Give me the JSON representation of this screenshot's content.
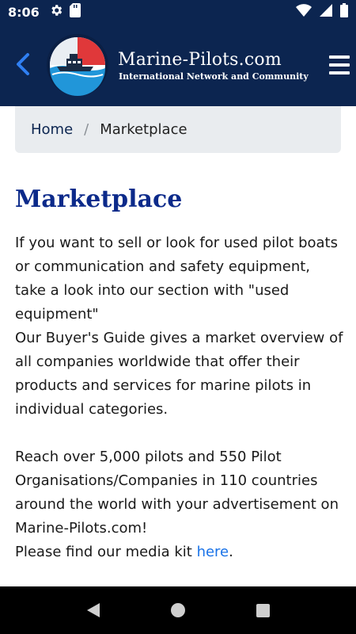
{
  "status_bar": {
    "time": "8:06",
    "icons_left": [
      "gear-icon",
      "sd-card-icon"
    ],
    "icons_right": [
      "wifi-icon",
      "signal-icon",
      "battery-icon"
    ]
  },
  "header": {
    "title": "Marine-Pilots.com",
    "subtitle": "International Network and Community",
    "background_color": "#0c2550"
  },
  "breadcrumb": {
    "home": "Home",
    "separator": "/",
    "current": "Marketplace"
  },
  "page": {
    "title": "Marketplace",
    "p1": "If you want to sell or look for used pilot boats or communication and safety equipment, take a look into our section with \"used equipment\"",
    "p2": "Our Buyer's Guide gives a market overview of all companies worldwide that offer their products and services for marine pilots in individual categories.",
    "p3": "Reach over 5,000 pilots and 550 Pilot Organisations/Companies in 110 countries around the world with your advertisement on Marine-Pilots.com!",
    "p4_prefix": "Please find our media kit ",
    "p4_link": "here",
    "p4_suffix": "."
  },
  "colors": {
    "title_color": "#0c2a8a",
    "link_color": "#1a73e8"
  }
}
